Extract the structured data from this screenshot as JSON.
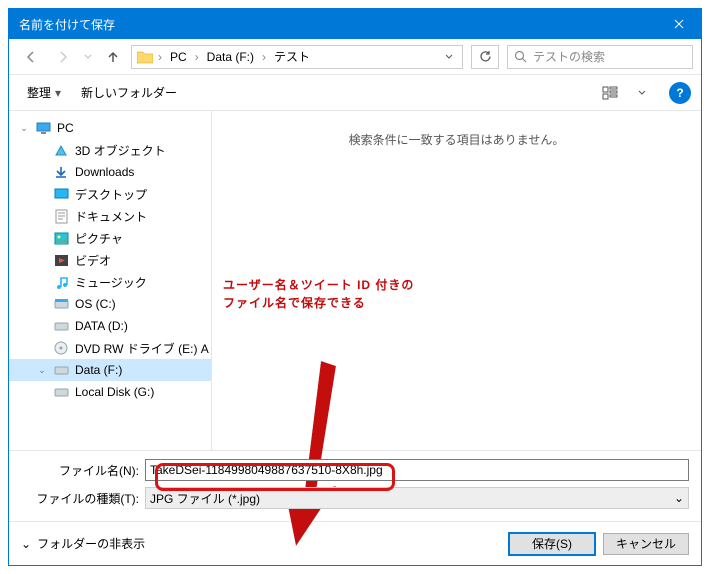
{
  "title": "名前を付けて保存",
  "breadcrumb": {
    "items": [
      "PC",
      "Data (F:)",
      "テスト"
    ]
  },
  "search": {
    "placeholder": "テストの検索"
  },
  "toolbar": {
    "organize": "整理",
    "newfolder": "新しいフォルダー"
  },
  "tree": {
    "pc": "PC",
    "items": [
      "3D オブジェクト",
      "Downloads",
      "デスクトップ",
      "ドキュメント",
      "ピクチャ",
      "ビデオ",
      "ミュージック",
      "OS (C:)",
      "DATA (D:)",
      "DVD RW ドライブ (E:) A",
      "Data (F:)",
      "Local Disk (G:)"
    ],
    "selected_index": 10
  },
  "content": {
    "empty": "検索条件に一致する項目はありません。"
  },
  "annotation": {
    "line1": "ユーザー名＆ツイート ID 付きの",
    "line2": "ファイル名で保存できる"
  },
  "form": {
    "filename_label": "ファイル名(N):",
    "filename_value": "TakeDSei-1184998049887637510-8X8h.jpg",
    "filetype_label": "ファイルの種類(T):",
    "filetype_value": "JPG ファイル (*.jpg)"
  },
  "actions": {
    "hide_folders": "フォルダーの非表示",
    "save": "保存(S)",
    "cancel": "キャンセル"
  },
  "help_glyph": "?"
}
